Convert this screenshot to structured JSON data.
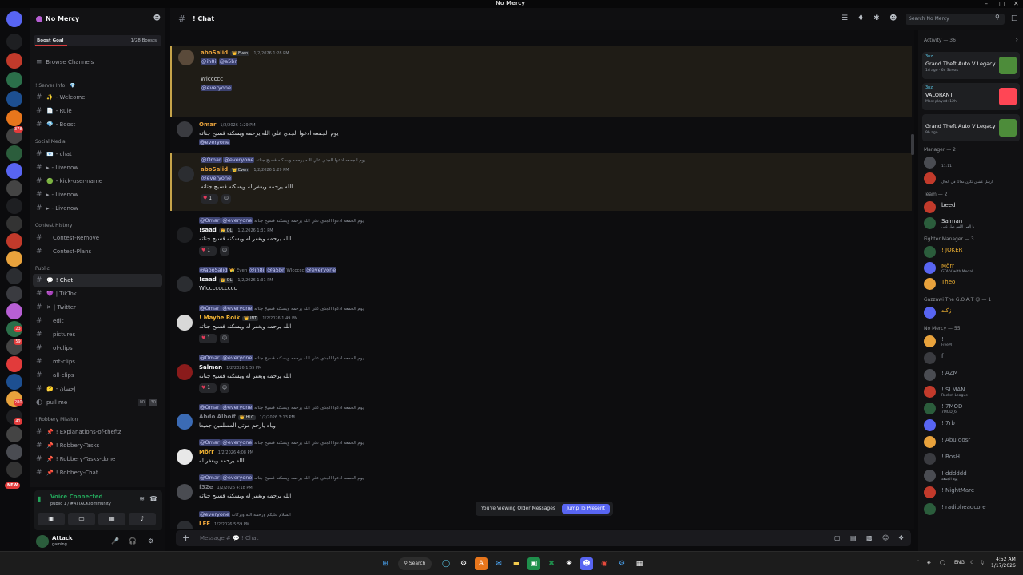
{
  "app": {
    "title": "No Mercy"
  },
  "server": {
    "name": "No Mercy",
    "boost_label": "Boost Goal",
    "boost_count": "1/28 Boosts"
  },
  "nav": {
    "browse": "Browse Channels"
  },
  "categories": {
    "info": "! Server Info · 💎",
    "social": "Social Media",
    "contest": "Contest History",
    "public": "Public",
    "robbery": "! Robbery Mission"
  },
  "channels": {
    "info": [
      {
        "icon": "✨",
        "label": "- Welcome"
      },
      {
        "icon": "📄",
        "label": "- Rule"
      },
      {
        "icon": "💎",
        "label": "- Boost"
      }
    ],
    "social": [
      {
        "icon": "📧",
        "label": "- chat"
      },
      {
        "icon": "▸",
        "label": "- Livenow"
      },
      {
        "icon": "🟢",
        "label": "- kick-user-name"
      },
      {
        "icon": "▸",
        "label": "- Livenow"
      },
      {
        "icon": "▸",
        "label": "- Livenow"
      }
    ],
    "contest": [
      {
        "icon": "",
        "label": "! Contest-Remove"
      },
      {
        "icon": "",
        "label": "! Contest-Plans"
      }
    ],
    "public": [
      {
        "icon": "💬",
        "label": "! Chat"
      },
      {
        "icon": "💜",
        "label": "| TikTok"
      },
      {
        "icon": "✕",
        "label": "| Twitter"
      },
      {
        "icon": "",
        "label": "! edit"
      },
      {
        "icon": "",
        "label": "! pictures"
      },
      {
        "icon": "",
        "label": "! ol-clips"
      },
      {
        "icon": "",
        "label": "! mt-clips"
      },
      {
        "icon": "",
        "label": "! all-clips"
      },
      {
        "icon": "🤔",
        "label": "- إحسان"
      }
    ],
    "voice": {
      "label": "pull me",
      "count": "00",
      "limit": "30"
    },
    "robbery": [
      {
        "icon": "📌",
        "label": "! Explanations-of-theftz"
      },
      {
        "icon": "📌",
        "label": "! Robbery-Tasks"
      },
      {
        "icon": "📌",
        "label": "! Robbery-Tasks-done"
      },
      {
        "icon": "📌",
        "label": "! Robbery-Chat"
      }
    ]
  },
  "guild_badges": [
    "378",
    "23",
    "59",
    "280",
    "41"
  ],
  "new_badge": "NEW",
  "voice": {
    "status": "Voice Connected",
    "channel": "public 1 / #ATTACKcommunity"
  },
  "user": {
    "name": "Attack",
    "status": "gaming"
  },
  "channel": {
    "name": "! Chat",
    "search_placeholder": "Search No Mercy",
    "composer_placeholder": "Message # 💬 ! Chat"
  },
  "messages": [
    {
      "author": "aboSalid",
      "tag": "👑 Even",
      "time": "1/2/2026 1:28 PM",
      "lines": [
        "@ih8i @a5br",
        "",
        "Wlccccc",
        "@everyone"
      ],
      "color": "#e8a23c"
    },
    {
      "author": "Omar",
      "tag": "",
      "time": "1/2/2026 1:29 PM",
      "lines": [
        "يوم الجمعه ادعوا الجدي علي الله يرحمه ويسكنه فسيح جناته",
        "@everyone"
      ],
      "color": "#e8a23c"
    },
    {
      "author": "aboSalid",
      "tag": "👑 Even",
      "time": "1/2/2026 1:29 PM",
      "reply": "@Omar @everyone يوم الجمعه ادعوا الجدي علي الله يرحمه ويسكنه فسيح جناته",
      "lines": [
        "@everyone",
        "الله يرحمه ويغفر له ويسكنه فسيح جناته"
      ],
      "react": "1",
      "color": "#e8a23c"
    },
    {
      "author": "!saad",
      "tag": "👑 OL",
      "time": "1/2/2026 1:31 PM",
      "reply": "@Omar @everyone يوم الجمعه ادعوا الجدي علي الله يرحمه ويسكنه فسيح جناته",
      "lines": [
        "الله يرحمه ويغفر له ويسكنه فسيح جناته"
      ],
      "react": "1",
      "color": "#f2f3f5"
    },
    {
      "author": "!saad",
      "tag": "👑 OL",
      "time": "1/2/2026 1:31 PM",
      "reply": "@aboSalid 👑 Even @ih8i @a5br  Wlccccc @everyone",
      "lines": [
        "Wlcccccccccc"
      ],
      "color": "#f2f3f5"
    },
    {
      "author": "! Maybe Roik",
      "tag": "👑 INT",
      "time": "1/2/2026 1:49 PM",
      "reply": "@Omar @everyone يوم الجمعه ادعوا الجدي علي الله يرحمه ويسكنه فسيح جناته",
      "lines": [
        "الله يرحمه ويغفر له ويسكنه فسيح جناته"
      ],
      "react": "1",
      "color": "#f0b232"
    },
    {
      "author": "Salman",
      "tag": "",
      "time": "1/2/2026 1:55 PM",
      "reply": "@Omar @everyone يوم الجمعه ادعوا الجدي علي الله يرحمه ويسكنه فسيح جناته",
      "lines": [
        "الله يرحمه ويغفر له ويسكنه فسيح جناته"
      ],
      "react": "1",
      "color": "#f2f3f5"
    },
    {
      "author": "Abdo Alboif",
      "tag": "👑 HLC",
      "time": "1/2/2026 3:13 PM",
      "reply": "@Omar @everyone يوم الجمعه ادعوا الجدي علي الله يرحمه ويسكنه فسيح جناته",
      "lines": [
        "وياه يارحم موتى المسلمين جميعا"
      ],
      "color": "#7d7f86"
    },
    {
      "author": "Mörr",
      "tag": "",
      "time": "1/2/2026 4:08 PM",
      "reply": "@Omar @everyone يوم الجمعه ادعوا الجدي علي الله يرحمه ويسكنه فسيح جناته",
      "lines": [
        "الله يرحمه ويغفر له"
      ],
      "color": "#f0b232"
    },
    {
      "author": "f32e",
      "tag": "",
      "time": "1/2/2026 4:18 PM",
      "reply": "@Omar @everyone يوم الجمعه ادعوا الجدي علي الله يرحمه ويسكنه فسيح جناته",
      "lines": [
        "الله يرحمه ويغفر له ويسكنه فسيح جناته"
      ],
      "color": "#7d7f86"
    },
    {
      "author": "LEF",
      "tag": "",
      "time": "1/2/2026 5:59 PM",
      "reply": "@everyone السلام عليكم ورحمة الله وبركاته",
      "lines": [
        "الله يرحمه ويغفر له"
      ],
      "color": "#e8a23c"
    }
  ],
  "older_banner": {
    "text": "You're Viewing Older Messages",
    "button": "Jump To Present"
  },
  "activity": {
    "header": "Activity — 36",
    "cards": [
      {
        "user": "3nzi",
        "game": "Grand Theft Auto V Legacy",
        "sub": "1d ago · 6x Streak",
        "color": "#4d8c3a"
      },
      {
        "user": "3nzi",
        "game": "VALORANT",
        "sub": "Most played: 12h",
        "color": "#ff4655"
      },
      {
        "user": "",
        "game": "Grand Theft Auto V Legacy",
        "sub": "9h ago",
        "color": "#4d8c3a"
      }
    ]
  },
  "member_groups": [
    {
      "header": "Manager — 2",
      "members": [
        {
          "name": "",
          "sub": "11:11",
          "color": "#dbdee1"
        },
        {
          "name": "",
          "sub": "ارسل عشان تكون معاك في الحال",
          "color": "#dbdee1"
        }
      ]
    },
    {
      "header": "Team — 2",
      "members": [
        {
          "name": "beed",
          "sub": "",
          "color": "#dbdee1"
        },
        {
          "name": "Salman",
          "sub": "يا إلهي اللهم صل على",
          "color": "#dbdee1"
        }
      ]
    },
    {
      "header": "Fighter Manager — 3",
      "members": [
        {
          "name": "! JOKER",
          "sub": "",
          "color": "#f0b232"
        },
        {
          "name": "Mörr",
          "sub": "GTA V with Medal",
          "color": "#f0b232"
        },
        {
          "name": "Theo",
          "sub": "",
          "color": "#f0b232"
        }
      ]
    },
    {
      "header": "Gazzawi The G.O.A.T 😊 — 1",
      "members": [
        {
          "name": "زكند",
          "sub": "",
          "color": "#f0b232"
        }
      ]
    },
    {
      "header": "No Mercy — 55",
      "members": [
        {
          "name": "!",
          "sub": "FiveM",
          "color": "#949ba4"
        },
        {
          "name": "f",
          "sub": "",
          "color": "#949ba4"
        },
        {
          "name": "! AZM",
          "sub": "",
          "color": "#949ba4"
        },
        {
          "name": "! SLMAN",
          "sub": "Rocket League",
          "color": "#949ba4"
        },
        {
          "name": "! 7MOD",
          "sub": "7MOD_6",
          "color": "#949ba4"
        },
        {
          "name": "! 7rb",
          "sub": "",
          "color": "#949ba4"
        },
        {
          "name": "! Abu dosr",
          "sub": "",
          "color": "#949ba4"
        },
        {
          "name": "! BosH",
          "sub": "",
          "color": "#949ba4"
        },
        {
          "name": "! dddddd",
          "sub": "يوم الجمعه",
          "color": "#949ba4"
        },
        {
          "name": "! NightMare",
          "sub": "",
          "color": "#949ba4"
        },
        {
          "name": "! radioheadcore",
          "sub": "",
          "color": "#949ba4"
        }
      ]
    }
  ],
  "taskbar": {
    "search": "Search",
    "lang": "ENG",
    "time": "4:52 AM",
    "date": "1/17/2026"
  }
}
